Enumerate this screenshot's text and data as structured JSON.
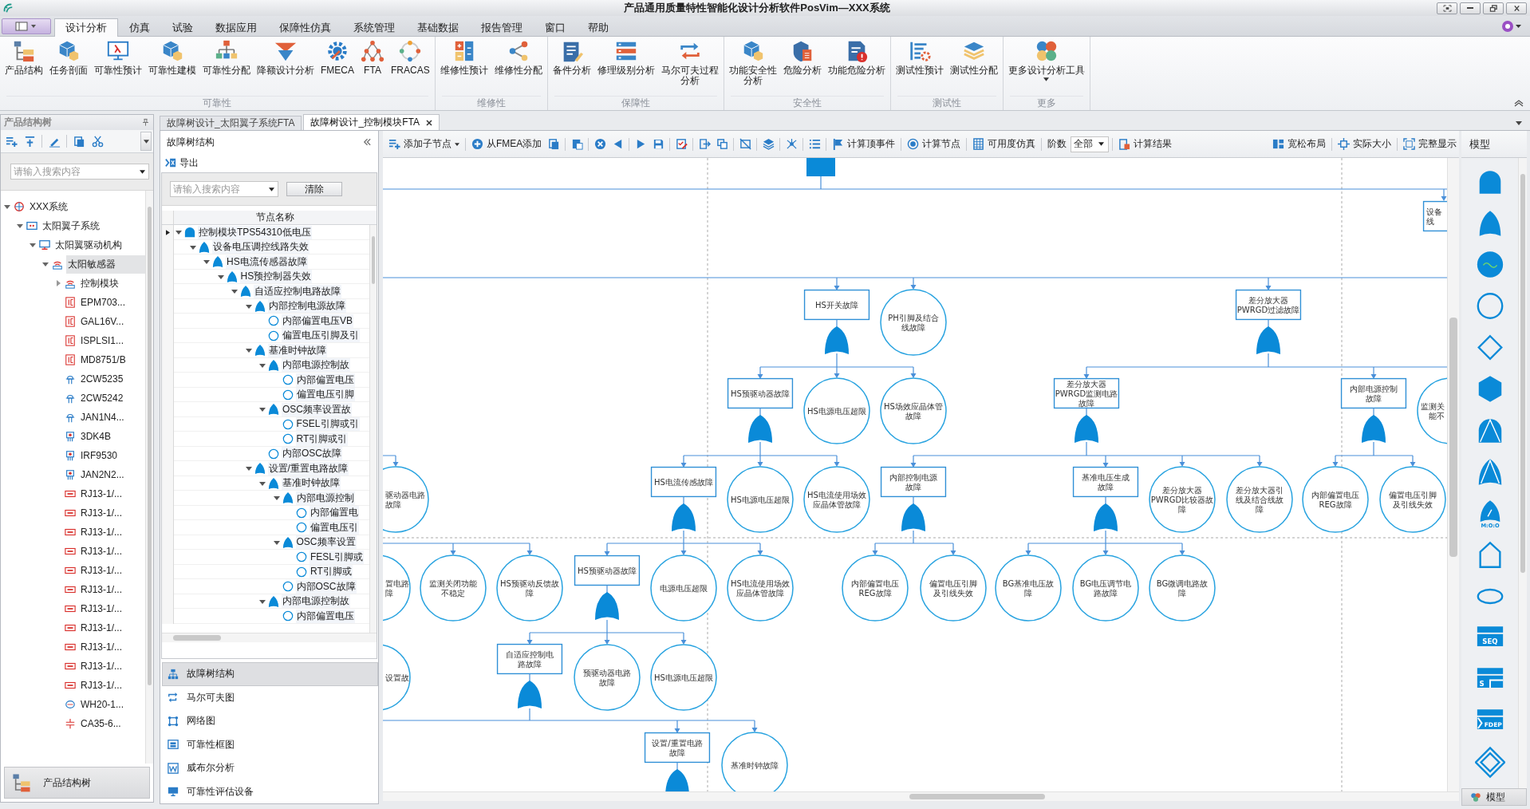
{
  "window": {
    "title": "产品通用质量特性智能化设计分析软件PosVim—XXX系统"
  },
  "menu_tabs": [
    {
      "label": "设计分析",
      "selected": true
    },
    {
      "label": "仿真",
      "selected": false
    },
    {
      "label": "试验",
      "selected": false
    },
    {
      "label": "数据应用",
      "selected": false
    },
    {
      "label": "保障性仿真",
      "selected": false
    },
    {
      "label": "系统管理",
      "selected": false
    },
    {
      "label": "基础数据",
      "selected": false
    },
    {
      "label": "报告管理",
      "selected": false
    },
    {
      "label": "窗口",
      "selected": false
    },
    {
      "label": "帮助",
      "selected": false
    }
  ],
  "ribbon": [
    {
      "label": "可靠性",
      "buttons": [
        {
          "label": [
            "产品结构"
          ]
        },
        {
          "label": [
            "任务剖面"
          ]
        },
        {
          "label": [
            "可靠性预计"
          ]
        },
        {
          "label": [
            "可靠性建模"
          ]
        },
        {
          "label": [
            "可靠性分配"
          ]
        },
        {
          "label": [
            "降额设计分析"
          ]
        },
        {
          "label": [
            "FMECA"
          ]
        },
        {
          "label": [
            "FTA"
          ]
        },
        {
          "label": [
            "FRACAS"
          ]
        }
      ]
    },
    {
      "label": "维修性",
      "buttons": [
        {
          "label": [
            "维修性预计"
          ]
        },
        {
          "label": [
            "维修性分配"
          ]
        }
      ]
    },
    {
      "label": "保障性",
      "buttons": [
        {
          "label": [
            "备件分析"
          ]
        },
        {
          "label": [
            "修理级别分析"
          ]
        },
        {
          "label": [
            "马尔可夫过程",
            "分析"
          ]
        }
      ]
    },
    {
      "label": "安全性",
      "buttons": [
        {
          "label": [
            "功能安全性",
            "分析"
          ]
        },
        {
          "label": [
            "危险分析"
          ]
        },
        {
          "label": [
            "功能危险分析"
          ]
        }
      ]
    },
    {
      "label": "测试性",
      "buttons": [
        {
          "label": [
            "测试性预计"
          ]
        },
        {
          "label": [
            "测试性分配"
          ]
        }
      ]
    },
    {
      "label": "更多",
      "buttons": [
        {
          "label": [
            "更多设计分析工具"
          ],
          "dropdown": true
        }
      ]
    }
  ],
  "product_tree": {
    "title": "产品结构树",
    "search": {
      "placeholder": "请输入搜索内容"
    },
    "footer": "产品结构树",
    "items": [
      {
        "label": "XXX系统",
        "kind": "system",
        "expanded": true,
        "selected": false,
        "children": [
          {
            "label": "太阳翼子系统",
            "kind": "subsystem",
            "expanded": true,
            "selected": false,
            "children": [
              {
                "label": "太阳翼驱动机构",
                "kind": "mechanism",
                "expanded": true,
                "selected": false,
                "children": [
                  {
                    "label": "太阳敏感器",
                    "kind": "sensor",
                    "expanded": true,
                    "selected": true,
                    "children": [
                      {
                        "label": "控制模块",
                        "kind": "sensor",
                        "expanded": false,
                        "selected": false
                      },
                      {
                        "label": "EPM703...",
                        "kind": "ic",
                        "selected": false
                      },
                      {
                        "label": "GAL16V...",
                        "kind": "ic",
                        "selected": false
                      },
                      {
                        "label": "ISPLSI1...",
                        "kind": "ic",
                        "selected": false
                      },
                      {
                        "label": "MD8751/B",
                        "kind": "ic",
                        "selected": false
                      },
                      {
                        "label": "2CW5235",
                        "kind": "diode",
                        "selected": false
                      },
                      {
                        "label": "2CW5242",
                        "kind": "diode",
                        "selected": false
                      },
                      {
                        "label": "JAN1N4...",
                        "kind": "diode",
                        "selected": false
                      },
                      {
                        "label": "3DK4B",
                        "kind": "transistor",
                        "selected": false
                      },
                      {
                        "label": "IRF9530",
                        "kind": "transistor",
                        "selected": false
                      },
                      {
                        "label": "JAN2N2...",
                        "kind": "transistor",
                        "selected": false
                      },
                      {
                        "label": "RJ13-1/...",
                        "kind": "resistor",
                        "selected": false
                      },
                      {
                        "label": "RJ13-1/...",
                        "kind": "resistor",
                        "selected": false
                      },
                      {
                        "label": "RJ13-1/...",
                        "kind": "resistor",
                        "selected": false
                      },
                      {
                        "label": "RJ13-1/...",
                        "kind": "resistor",
                        "selected": false
                      },
                      {
                        "label": "RJ13-1/...",
                        "kind": "resistor",
                        "selected": false
                      },
                      {
                        "label": "RJ13-1/...",
                        "kind": "resistor",
                        "selected": false
                      },
                      {
                        "label": "RJ13-1/...",
                        "kind": "resistor",
                        "selected": false
                      },
                      {
                        "label": "RJ13-1/...",
                        "kind": "resistor",
                        "selected": false
                      },
                      {
                        "label": "RJ13-1/...",
                        "kind": "resistor",
                        "selected": false
                      },
                      {
                        "label": "RJ13-1/...",
                        "kind": "resistor",
                        "selected": false
                      },
                      {
                        "label": "RJ13-1/...",
                        "kind": "resistor",
                        "selected": false
                      },
                      {
                        "label": "WH20-1...",
                        "kind": "coil",
                        "selected": false
                      },
                      {
                        "label": "CA35-6...",
                        "kind": "capacitor",
                        "selected": false
                      }
                    ]
                  }
                ]
              }
            ]
          }
        ]
      }
    ]
  },
  "doc_tabs": [
    {
      "label": "故障树设计_太阳翼子系统FTA",
      "selected": false
    },
    {
      "label": "故障树设计_控制模块FTA",
      "selected": true
    }
  ],
  "structure_panel": {
    "title": "故障树结构",
    "export": "导出",
    "search": {
      "placeholder": "请输入搜索内容"
    },
    "clear": "清除",
    "column": "节点名称",
    "rows": [
      {
        "kind": "and",
        "label": "控制模块TPS54310低电压",
        "selected": true,
        "expanded": true,
        "children": [
          {
            "kind": "or",
            "label": "设备电压调控线路失效",
            "selected": false,
            "expanded": true,
            "children": [
              {
                "kind": "or",
                "label": "HS电流传感器故障",
                "selected": false,
                "expanded": true,
                "children": [
                  {
                    "kind": "or",
                    "label": "HS预控制器失效",
                    "selected": false,
                    "expanded": true,
                    "children": [
                      {
                        "kind": "or",
                        "label": "自适应控制电路故障",
                        "selected": false,
                        "expanded": true,
                        "children": [
                          {
                            "kind": "or",
                            "label": "内部控制电源故障",
                            "selected": false,
                            "expanded": true,
                            "children": [
                              {
                                "kind": "basic",
                                "label": "内部偏置电压VB",
                                "selected": false
                              },
                              {
                                "kind": "basic",
                                "label": "偏置电压引脚及引",
                                "selected": false
                              }
                            ]
                          },
                          {
                            "kind": "or",
                            "label": "基准时钟故障",
                            "selected": false,
                            "expanded": true,
                            "children": [
                              {
                                "kind": "or",
                                "label": "内部电源控制故",
                                "selected": false,
                                "expanded": true,
                                "children": [
                                  {
                                    "kind": "basic",
                                    "label": "内部偏置电压",
                                    "selected": false
                                  },
                                  {
                                    "kind": "basic",
                                    "label": "偏置电压引脚",
                                    "selected": false
                                  }
                                ]
                              },
                              {
                                "kind": "or",
                                "label": "OSC频率设置故",
                                "selected": false,
                                "expanded": true,
                                "children": [
                                  {
                                    "kind": "basic",
                                    "label": "FSEL引脚或引",
                                    "selected": false
                                  },
                                  {
                                    "kind": "basic",
                                    "label": "RT引脚或引",
                                    "selected": false
                                  }
                                ]
                              },
                              {
                                "kind": "basic",
                                "label": "内部OSC故障",
                                "selected": false
                              }
                            ]
                          },
                          {
                            "kind": "or",
                            "label": "设置/重置电路故障",
                            "selected": false,
                            "expanded": true,
                            "children": [
                              {
                                "kind": "or",
                                "label": "基准时钟故障",
                                "selected": false,
                                "expanded": true,
                                "children": [
                                  {
                                    "kind": "or",
                                    "label": "内部电源控制",
                                    "selected": false,
                                    "expanded": true,
                                    "children": [
                                      {
                                        "kind": "basic",
                                        "label": "内部偏置电",
                                        "selected": false
                                      },
                                      {
                                        "kind": "basic",
                                        "label": "偏置电压引",
                                        "selected": false
                                      }
                                    ]
                                  },
                                  {
                                    "kind": "or",
                                    "label": "OSC频率设置",
                                    "selected": false,
                                    "expanded": true,
                                    "children": [
                                      {
                                        "kind": "basic",
                                        "label": "FESL引脚或",
                                        "selected": false
                                      },
                                      {
                                        "kind": "basic",
                                        "label": "RT引脚或",
                                        "selected": false
                                      }
                                    ]
                                  },
                                  {
                                    "kind": "basic",
                                    "label": "内部OSC故障",
                                    "selected": false
                                  }
                                ]
                              },
                              {
                                "kind": "or",
                                "label": "内部电源控制故",
                                "selected": false,
                                "expanded": true,
                                "children": [
                                  {
                                    "kind": "basic",
                                    "label": "内部偏置电压",
                                    "selected": false
                                  }
                                ]
                              }
                            ]
                          }
                        ]
                      }
                    ]
                  }
                ]
              }
            ]
          }
        ]
      }
    ],
    "nav": [
      {
        "label": "故障树结构",
        "selected": true
      },
      {
        "label": "马尔可夫图",
        "selected": false
      },
      {
        "label": "网络图",
        "selected": false
      },
      {
        "label": "可靠性框图",
        "selected": false
      },
      {
        "label": "威布尔分析",
        "selected": false
      },
      {
        "label": "可靠性评估设备",
        "selected": false
      }
    ]
  },
  "toolbar": {
    "add_child": "添加子节点",
    "from_fmea": "从FMEA添加",
    "commands": [
      "计算顶事件",
      "计算节点",
      "可用度仿真"
    ],
    "order_label": "阶数",
    "order_value": "全部",
    "result": "计算结果",
    "view": [
      "宽松布局",
      "实际大小",
      "完整显示"
    ]
  },
  "canvas": {
    "nodes": [
      {
        "kind": "top"
      },
      {
        "kind": "event",
        "lines": [
          "设备",
          "线"
        ]
      },
      {
        "kind": "event",
        "lines": [
          "HS开关故障"
        ],
        "gate": {
          "kind": "or"
        }
      },
      {
        "kind": "basic",
        "lines": [
          "PH引脚及结合",
          "线故障"
        ]
      },
      {
        "kind": "event",
        "lines": [
          "差分放大器",
          "PWRGD过滤故障"
        ],
        "gate": {
          "kind": "or"
        }
      },
      {
        "kind": "event",
        "lines": [
          "HS预驱动器故障"
        ],
        "gate": {
          "kind": "or"
        }
      },
      {
        "kind": "basic",
        "lines": [
          "HS电源电压超限"
        ]
      },
      {
        "kind": "basic",
        "lines": [
          "HS场效应晶体管",
          "故障"
        ]
      },
      {
        "kind": "event",
        "lines": [
          "差分放大器",
          "PWRGD监测电路",
          "故障"
        ],
        "gate": {
          "kind": "or"
        }
      },
      {
        "kind": "event",
        "lines": [
          "内部电源控制",
          "故障"
        ],
        "gate": {
          "kind": "or"
        }
      },
      {
        "kind": "basic",
        "lines": [
          "监测关",
          "能不"
        ]
      },
      {
        "kind": "basic",
        "lines": [
          "驱动器电路",
          "故障"
        ]
      },
      {
        "kind": "event",
        "lines": [
          "HS电流传感故障"
        ],
        "gate": {
          "kind": "or"
        }
      },
      {
        "kind": "basic",
        "lines": [
          "HS电源电压超限"
        ]
      },
      {
        "kind": "basic",
        "lines": [
          "HS电流使用场效",
          "应晶体管故障"
        ]
      },
      {
        "kind": "event",
        "lines": [
          "内部控制电源",
          "故障"
        ],
        "gate": {
          "kind": "or"
        }
      },
      {
        "kind": "event",
        "lines": [
          "基准电压生成",
          "故障"
        ],
        "gate": {
          "kind": "or"
        }
      },
      {
        "kind": "basic",
        "lines": [
          "差分放大器",
          "PWRGD比较器故",
          "障"
        ]
      },
      {
        "kind": "basic",
        "lines": [
          "差分放大器引",
          "线及结合线故",
          "障"
        ]
      },
      {
        "kind": "basic",
        "lines": [
          "内部偏置电压",
          "REG故障"
        ]
      },
      {
        "kind": "basic",
        "lines": [
          "偏置电压引脚",
          "及引线失效"
        ]
      },
      {
        "kind": "basic",
        "lines": [
          "置电路",
          "障"
        ]
      },
      {
        "kind": "basic",
        "lines": [
          "监测关闭功能",
          "不稳定"
        ]
      },
      {
        "kind": "basic",
        "lines": [
          "HS预驱动反馈故",
          "障"
        ]
      },
      {
        "kind": "event",
        "lines": [
          "HS预驱动器故障"
        ],
        "gate": {
          "kind": "or"
        }
      },
      {
        "kind": "basic",
        "lines": [
          "电源电压超限"
        ]
      },
      {
        "kind": "basic",
        "lines": [
          "HS电流使用场效",
          "应晶体管故障"
        ]
      },
      {
        "kind": "basic",
        "lines": [
          "内部偏置电压",
          "REG故障"
        ]
      },
      {
        "kind": "basic",
        "lines": [
          "偏置电压引脚",
          "及引线失效"
        ]
      },
      {
        "kind": "basic",
        "lines": [
          "BG基准电压故",
          "障"
        ]
      },
      {
        "kind": "basic",
        "lines": [
          "BG电压调节电",
          "路故障"
        ]
      },
      {
        "kind": "basic",
        "lines": [
          "BG微调电路故",
          "障"
        ]
      },
      {
        "kind": "basic",
        "lines": [
          "设置故"
        ]
      },
      {
        "kind": "event",
        "lines": [
          "自适应控制电",
          "路故障"
        ],
        "gate": {
          "kind": "or"
        }
      },
      {
        "kind": "basic",
        "lines": [
          "预驱动器电路",
          "故障"
        ]
      },
      {
        "kind": "basic",
        "lines": [
          "HS电源电压超限"
        ]
      },
      {
        "kind": "event",
        "lines": [
          "设置/重置电路",
          "故障"
        ],
        "gate": {
          "kind": "or"
        }
      },
      {
        "kind": "basic",
        "lines": [
          "基准时钟故障"
        ]
      }
    ]
  },
  "palette": {
    "title": "模型",
    "footer": "模型",
    "items": [
      {
        "kind": "and-gate"
      },
      {
        "kind": "or-gate"
      },
      {
        "kind": "wave-circle"
      },
      {
        "kind": "circle"
      },
      {
        "kind": "diamond"
      },
      {
        "kind": "hexagon"
      },
      {
        "kind": "split-dome"
      },
      {
        "kind": "split-arch"
      },
      {
        "kind": "vote-gate",
        "label": "M:O:O"
      },
      {
        "kind": "house"
      },
      {
        "kind": "ellipse"
      },
      {
        "kind": "seq-gate",
        "label": "SEQ"
      },
      {
        "kind": "spare-gate",
        "label": "S"
      },
      {
        "kind": "fdep-gate",
        "label": "FDEP"
      },
      {
        "kind": "double-diamond"
      }
    ]
  }
}
